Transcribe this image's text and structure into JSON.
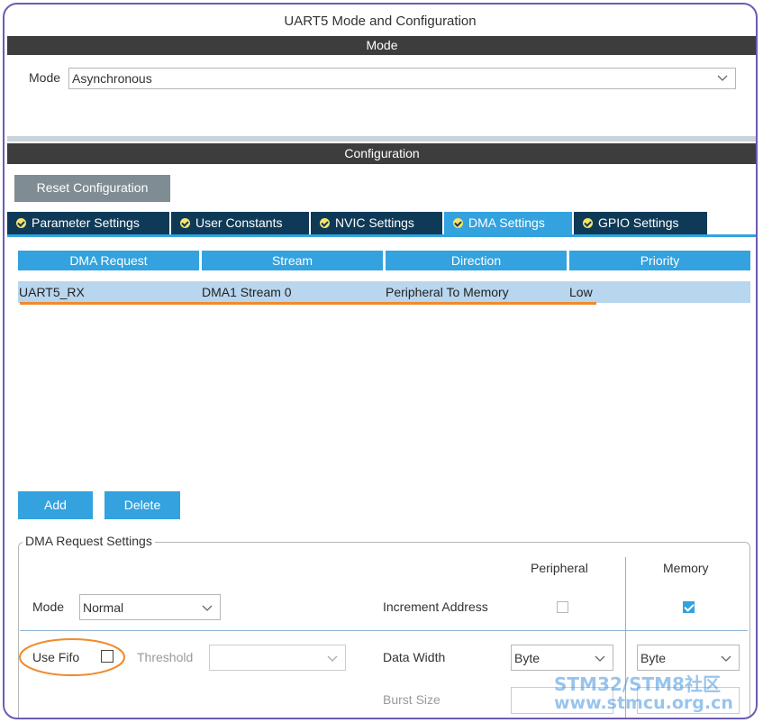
{
  "window": {
    "title": "UART5 Mode and Configuration"
  },
  "mode_section": {
    "header": "Mode",
    "mode_label": "Mode",
    "mode_value": "Asynchronous"
  },
  "config_section": {
    "header": "Configuration",
    "reset_button": "Reset Configuration",
    "tabs": [
      {
        "label": "Parameter Settings",
        "active": false
      },
      {
        "label": "User Constants",
        "active": false
      },
      {
        "label": "NVIC Settings",
        "active": false
      },
      {
        "label": "DMA Settings",
        "active": true
      },
      {
        "label": "GPIO Settings",
        "active": false
      }
    ]
  },
  "dma_table": {
    "columns": [
      "DMA Request",
      "Stream",
      "Direction",
      "Priority"
    ],
    "rows": [
      {
        "request": "UART5_RX",
        "stream": "DMA1 Stream 0",
        "direction": "Peripheral To Memory",
        "priority": "Low"
      }
    ]
  },
  "actions": {
    "add": "Add",
    "delete": "Delete"
  },
  "request_settings": {
    "legend": "DMA Request Settings",
    "peripheral_header": "Peripheral",
    "memory_header": "Memory",
    "mode_label": "Mode",
    "mode_value": "Normal",
    "increment_address_label": "Increment Address",
    "peripheral_increment": false,
    "memory_increment": true,
    "use_fifo_label": "Use Fifo",
    "use_fifo": false,
    "threshold_label": "Threshold",
    "threshold_value": "",
    "data_width_label": "Data Width",
    "peripheral_data_width": "Byte",
    "memory_data_width": "Byte",
    "burst_size_label": "Burst Size"
  },
  "watermark": {
    "line1": "STM32/STM8社区",
    "line2": "www.stmcu.org.cn"
  },
  "colors": {
    "accent_blue": "#33a2de",
    "tab_dark": "#0f3a57",
    "header_dark": "#3d3d3d",
    "selected_row": "#b8d6ee",
    "annotation_orange": "#f08a2c",
    "frame_purple": "#6c5bb3"
  }
}
